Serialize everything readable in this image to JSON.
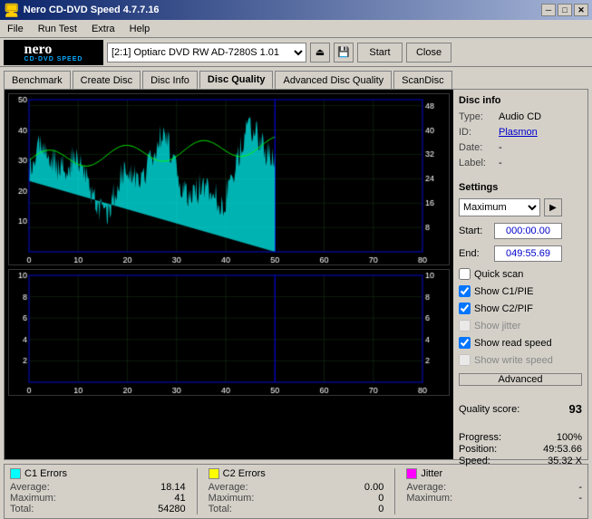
{
  "titleBar": {
    "title": "Nero CD-DVD Speed 4.7.7.16",
    "icon": "●",
    "btnMin": "─",
    "btnMax": "□",
    "btnClose": "✕"
  },
  "menuBar": {
    "items": [
      "File",
      "Run Test",
      "Extra",
      "Help"
    ]
  },
  "toolbar": {
    "logo": "nero\nCD·DVD SPEED",
    "driveValue": "[2:1] Optiarc DVD RW AD-7280S 1.01",
    "startLabel": "Start",
    "closeLabel": "Close"
  },
  "tabs": {
    "items": [
      "Benchmark",
      "Create Disc",
      "Disc Info",
      "Disc Quality",
      "Advanced Disc Quality",
      "ScanDisc"
    ],
    "activeIndex": 3
  },
  "discInfo": {
    "sectionTitle": "Disc info",
    "type": {
      "label": "Type:",
      "value": "Audio CD"
    },
    "id": {
      "label": "ID:",
      "value": "Plasmon"
    },
    "date": {
      "label": "Date:",
      "value": "-"
    },
    "label": {
      "label": "Label:",
      "value": "-"
    }
  },
  "settings": {
    "sectionTitle": "Settings",
    "speedValue": "Maximum",
    "startLabel": "Start:",
    "startTime": "000:00.00",
    "endLabel": "End:",
    "endTime": "049:55.69",
    "checkboxes": {
      "quickScan": {
        "label": "Quick scan",
        "checked": false
      },
      "showC1PIE": {
        "label": "Show C1/PIE",
        "checked": true
      },
      "showC2PIF": {
        "label": "Show C2/PIF",
        "checked": true
      },
      "showJitter": {
        "label": "Show jitter",
        "checked": false
      },
      "showReadSpeed": {
        "label": "Show read speed",
        "checked": true
      },
      "showWriteSpeed": {
        "label": "Show write speed",
        "checked": false
      }
    },
    "advancedLabel": "Advanced"
  },
  "quality": {
    "label": "Quality score:",
    "value": "93"
  },
  "progress": {
    "progressLabel": "Progress:",
    "progressValue": "100%",
    "positionLabel": "Position:",
    "positionValue": "49:53.66",
    "speedLabel": "Speed:",
    "speedValue": "35.32 X"
  },
  "stats": {
    "c1Errors": {
      "title": "C1 Errors",
      "color": "#00ffff",
      "avgLabel": "Average:",
      "avgValue": "18.14",
      "maxLabel": "Maximum:",
      "maxValue": "41",
      "totalLabel": "Total:",
      "totalValue": "54280"
    },
    "c2Errors": {
      "title": "C2 Errors",
      "color": "#ffff00",
      "avgLabel": "Average:",
      "avgValue": "0.00",
      "maxLabel": "Maximum:",
      "maxValue": "0",
      "totalLabel": "Total:",
      "totalValue": "0"
    },
    "jitter": {
      "title": "Jitter",
      "color": "#ff00ff",
      "avgLabel": "Average:",
      "avgValue": "-",
      "maxLabel": "Maximum:",
      "maxValue": "-"
    }
  },
  "chart": {
    "topYMax": 50,
    "topYLabels": [
      48,
      40,
      32,
      24,
      16,
      8
    ],
    "bottomYMax": 10,
    "bottomYLabels": [
      10,
      8,
      6,
      4,
      2
    ],
    "xLabels": [
      0,
      10,
      20,
      30,
      40,
      50,
      60,
      70,
      80
    ]
  }
}
